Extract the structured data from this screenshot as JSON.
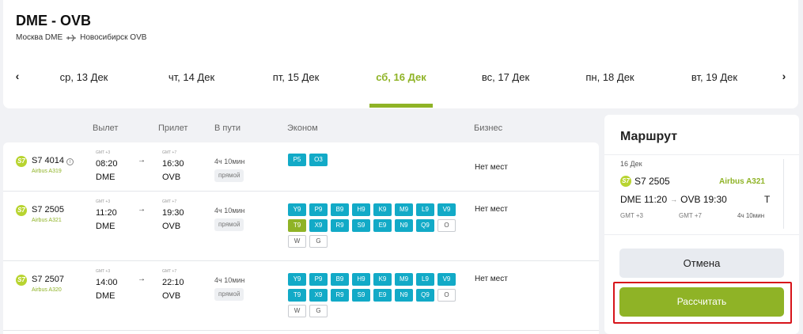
{
  "header": {
    "route_title": "DME - OVB",
    "from_label": "Москва DME",
    "to_label": "Новосибирск OVB"
  },
  "date_nav": {
    "prev_icon": "chevron-left-icon",
    "next_icon": "chevron-right-icon",
    "prev_glyph": "‹",
    "next_glyph": "›",
    "dates": [
      "ср, 13 Дек",
      "чт, 14 Дек",
      "пт, 15 Дек",
      "сб, 16 Дек",
      "вс, 17 Дек",
      "пн, 18 Дек",
      "вт, 19 Дек"
    ],
    "active_index": 3
  },
  "columns": {
    "departure": "Вылет",
    "arrival": "Прилет",
    "duration": "В пути",
    "economy": "Эконом",
    "business": "Бизнес"
  },
  "flights": [
    {
      "flight": "S7 4014",
      "aircraft": "Airbus A319",
      "dep_gmt": "GMT +3",
      "dep_time": "08:20",
      "dep_airport": "DME",
      "arr_gmt": "GMT +7",
      "arr_time": "16:30",
      "arr_airport": "OVB",
      "duration": "4ч 10мин",
      "type": "прямой",
      "fares": [
        "P5",
        "O3"
      ],
      "business": "Нет мест"
    },
    {
      "flight": "S7 2505",
      "aircraft": "Airbus A321",
      "dep_gmt": "GMT +3",
      "dep_time": "11:20",
      "dep_airport": "DME",
      "arr_gmt": "GMT +7",
      "arr_time": "19:30",
      "arr_airport": "OVB",
      "duration": "4ч 10мин",
      "type": "прямой",
      "fares": [
        "Y9",
        "P9",
        "B9",
        "H9",
        "K9",
        "M9",
        "L9",
        "V9",
        "T9",
        "X9",
        "R9",
        "S9",
        "E9",
        "N9",
        "Q9",
        "O",
        "W",
        "G"
      ],
      "selected_fare": "T9",
      "business": "Нет мест"
    },
    {
      "flight": "S7 2507",
      "aircraft": "Airbus A320",
      "dep_gmt": "GMT +3",
      "dep_time": "14:00",
      "dep_airport": "DME",
      "arr_gmt": "GMT +7",
      "arr_time": "22:10",
      "arr_airport": "OVB",
      "duration": "4ч 10мин",
      "type": "прямой",
      "fares": [
        "Y9",
        "P9",
        "B9",
        "H9",
        "K9",
        "M9",
        "L9",
        "V9",
        "T9",
        "X9",
        "R9",
        "S9",
        "E9",
        "N9",
        "Q9",
        "O",
        "W",
        "G"
      ],
      "business": "Нет мест"
    }
  ],
  "sidebar": {
    "title": "Маршрут",
    "date": "16 Дек",
    "flight": "S7 2505",
    "aircraft": "Airbus A321",
    "dep": "DME 11:20",
    "arr": "OVB 19:30",
    "fare_class": "T",
    "dep_gmt": "GMT +3",
    "arr_gmt": "GMT +7",
    "duration": "4ч 10мин",
    "cancel_label": "Отмена",
    "calc_label": "Рассчитать"
  },
  "colors": {
    "accent": "#8fb326",
    "fare": "#12aac7",
    "focus": "#d7141a"
  }
}
